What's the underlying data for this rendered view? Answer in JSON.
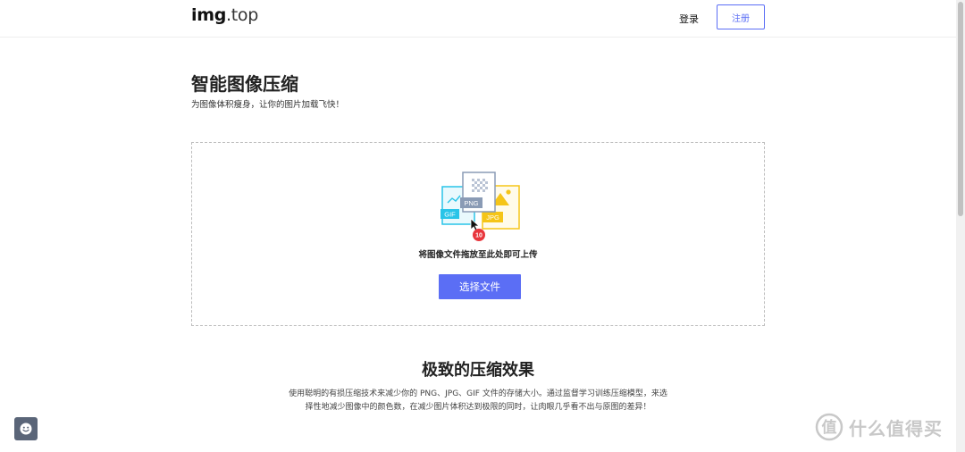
{
  "header": {
    "logo_main": "img",
    "logo_suffix": ".top",
    "login_label": "登录",
    "register_label": "注册"
  },
  "hero": {
    "title": "智能图像压缩",
    "subtitle": "为图像体积瘦身，让你的图片加载飞快！"
  },
  "dropzone": {
    "file_tags": [
      "GIF",
      "PNG",
      "JPG"
    ],
    "badge_count": "10",
    "instruction": "将图像文件拖放至此处即可上传",
    "select_button_label": "选择文件"
  },
  "feature": {
    "title": "极致的压缩效果",
    "description": "使用聪明的有损压缩技术来减少你的 PNG、JPG、GIF 文件的存储大小。通过监督学习训练压缩模型，来选择性地减少图像中的颜色数，在减少图片体积达到极限的同时，让肉眼几乎看不出与原图的差异！"
  },
  "colors": {
    "accent": "#5b6ef5",
    "gif": "#29c4e8",
    "png": "#8a9bb5",
    "jpg": "#f5c518",
    "badge": "#e8363d"
  },
  "icons": {
    "feedback": "smiley-icon",
    "watermark": "smzdm-logo"
  },
  "watermark": {
    "text": "什么值得买"
  }
}
